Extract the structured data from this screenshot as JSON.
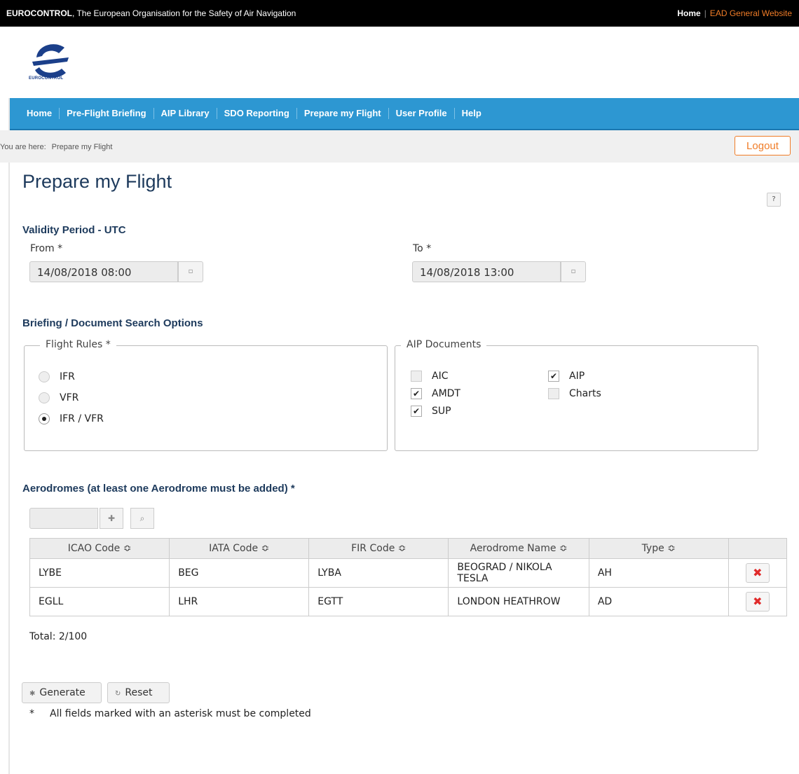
{
  "topbar": {
    "org_name": "EUROCONTROL",
    "org_desc": ", The European Organisation for the Safety of Air Navigation",
    "home_link": "Home",
    "ead_link": "EAD General Website"
  },
  "logo": {
    "text": "EUROCONTROL"
  },
  "nav": {
    "items": [
      "Home",
      "Pre-Flight Briefing",
      "AIP Library",
      "SDO Reporting",
      "Prepare my Flight",
      "User Profile",
      "Help"
    ]
  },
  "breadcrumb": {
    "label": "You are here:",
    "current": "Prepare my Flight"
  },
  "logout_label": "Logout",
  "page_title": "Prepare my Flight",
  "help_label": "?",
  "validity": {
    "title": "Validity Period - UTC",
    "from_label": "From *",
    "from_value": "14/08/2018 08:00",
    "to_label": "To *",
    "to_value": "14/08/2018 13:00"
  },
  "search_options": {
    "title": "Briefing / Document Search Options",
    "flight_rules": {
      "legend": "Flight Rules *",
      "options": [
        "IFR",
        "VFR",
        "IFR / VFR"
      ],
      "selected": "IFR / VFR"
    },
    "aip_documents": {
      "legend": "AIP Documents",
      "items": [
        {
          "label": "AIC",
          "checked": false
        },
        {
          "label": "AIP",
          "checked": true
        },
        {
          "label": "AMDT",
          "checked": true
        },
        {
          "label": "Charts",
          "checked": false
        },
        {
          "label": "SUP",
          "checked": true
        }
      ]
    }
  },
  "aerodromes": {
    "title": "Aerodromes (at least one Aerodrome must be added) *",
    "columns": [
      "ICAO Code ≎",
      "IATA Code ≎",
      "FIR Code ≎",
      "Aerodrome Name ≎",
      "Type ≎"
    ],
    "rows": [
      {
        "icao": "LYBE",
        "iata": "BEG",
        "fir": "LYBA",
        "name": "BEOGRAD / NIKOLA TESLA",
        "type": "AH"
      },
      {
        "icao": "EGLL",
        "iata": "LHR",
        "fir": "EGTT",
        "name": "LONDON HEATHROW",
        "type": "AD"
      }
    ],
    "total": "Total: 2/100"
  },
  "buttons": {
    "generate": "Generate",
    "reset": "Reset"
  },
  "footnote": {
    "star": "*",
    "text": "All fields marked with an asterisk must be completed"
  },
  "colors": {
    "nav_bg": "#2d97d2",
    "accent_orange": "#f07c27",
    "title_navy": "#1d3a5c",
    "delete_red": "#e02b2b"
  }
}
